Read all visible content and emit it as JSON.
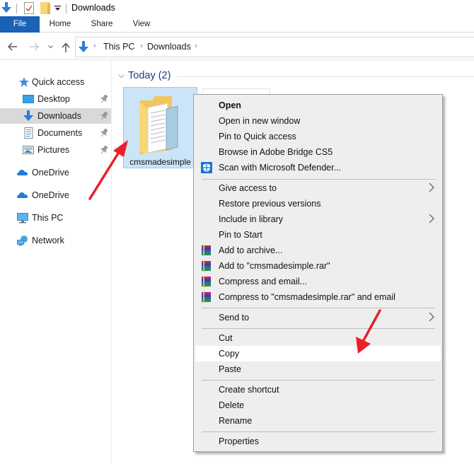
{
  "window": {
    "title": "Downloads",
    "qat_icons": [
      "downloads-arrow-icon",
      "properties-check-icon",
      "new-folder-icon",
      "customize-qat-icon"
    ]
  },
  "ribbon": {
    "tabs": [
      {
        "label": "File",
        "active": true
      },
      {
        "label": "Home"
      },
      {
        "label": "Share"
      },
      {
        "label": "View"
      }
    ]
  },
  "address_bar": {
    "nav_buttons": [
      "back",
      "forward",
      "recent",
      "up"
    ],
    "breadcrumbs": [
      "This PC",
      "Downloads"
    ]
  },
  "navpane": {
    "items": [
      {
        "label": "Quick access",
        "icon": "star-icon"
      },
      {
        "label": "Desktop",
        "icon": "desktop-icon",
        "pinned": true
      },
      {
        "label": "Downloads",
        "icon": "downloads-icon",
        "pinned": true,
        "selected": true
      },
      {
        "label": "Documents",
        "icon": "documents-icon",
        "pinned": true
      },
      {
        "label": "Pictures",
        "icon": "pictures-icon",
        "pinned": true
      },
      {
        "label": "OneDrive",
        "icon": "onedrive-icon"
      },
      {
        "label": "OneDrive",
        "icon": "onedrive-icon"
      },
      {
        "label": "This PC",
        "icon": "this-pc-icon"
      },
      {
        "label": "Network",
        "icon": "network-icon"
      }
    ]
  },
  "content": {
    "group_title": "Today (2)",
    "files": [
      {
        "name": "cmsmadesimple",
        "type": "folder",
        "selected": true
      }
    ]
  },
  "context_menu": {
    "items": [
      {
        "label": "Open",
        "bold": true
      },
      {
        "label": "Open in new window"
      },
      {
        "label": "Pin to Quick access"
      },
      {
        "label": "Browse in Adobe Bridge CS5"
      },
      {
        "label": "Scan with Microsoft Defender...",
        "icon": "defender-shield-icon"
      },
      {
        "label": "Give access to",
        "submenu": true
      },
      {
        "label": "Restore previous versions"
      },
      {
        "label": "Include in library",
        "submenu": true
      },
      {
        "label": "Pin to Start"
      },
      {
        "label": "Add to archive...",
        "icon": "winrar-icon"
      },
      {
        "label": "Add to \"cmsmadesimple.rar\"",
        "icon": "winrar-icon"
      },
      {
        "label": "Compress and email...",
        "icon": "winrar-icon"
      },
      {
        "label": "Compress to \"cmsmadesimple.rar\" and email",
        "icon": "winrar-icon"
      },
      {
        "label": "Send to",
        "submenu": true
      },
      {
        "label": "Cut"
      },
      {
        "label": "Copy",
        "highlighted": true
      },
      {
        "label": "Paste"
      },
      {
        "label": "Create shortcut"
      },
      {
        "label": "Delete"
      },
      {
        "label": "Rename"
      },
      {
        "label": "Properties"
      }
    ]
  },
  "annotations": {
    "arrow_color": "#e8202a",
    "arrows": [
      "pointing-to-folder",
      "pointing-to-copy"
    ]
  }
}
